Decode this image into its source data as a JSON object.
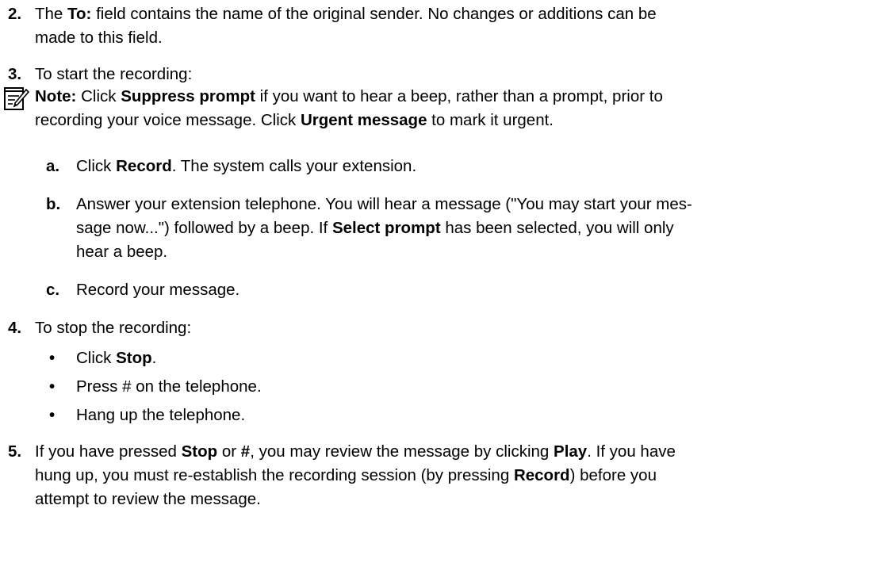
{
  "doc": {
    "s2": {
      "num": "2.",
      "p1": "The ",
      "b1": "To:",
      "p2": " field contains the name of the original sender. No changes or additions can be",
      "l2": "made to this field."
    },
    "s3": {
      "num": "3.",
      "text": "To start the recording:"
    },
    "note": {
      "label": "Note:",
      "p1": " Click ",
      "b1": "Suppress prompt",
      "p2": " if you want to hear a beep, rather than a prompt, prior to",
      "l2p1": "recording your voice message. Click ",
      "l2b1": "Urgent message",
      "l2p2": " to mark it urgent."
    },
    "a": {
      "label": "a.",
      "p1": "Click ",
      "b1": "Record",
      "p2": ". The system calls your extension."
    },
    "b": {
      "label": "b.",
      "l1": "Answer your extension telephone. You will hear a message (\"You may start your mes-",
      "l2p1": "sage now...\") followed by a beep. If ",
      "l2b1": "Select prompt",
      "l2p2": " has been selected, you will only",
      "l3": "hear a beep."
    },
    "c": {
      "label": "c.",
      "text": "Record your message."
    },
    "s4": {
      "num": "4.",
      "text": "To stop the recording:",
      "bullet": "•",
      "b1p1": "Click ",
      "b1b": "Stop",
      "b1p2": ".",
      "b2": "Press # on the telephone.",
      "b3": "Hang up the telephone."
    },
    "s5": {
      "num": "5.",
      "l1p1": "If you have pressed ",
      "l1b1": "Stop",
      "l1p2": " or ",
      "l1b2": "#",
      "l1p3": ", you may review the message by clicking ",
      "l1b3": "Play",
      "l1p4": ". If you have",
      "l2p1": "hung up, you must re-establish the recording session (by pressing ",
      "l2b1": "Record",
      "l2p2": ") before you",
      "l3": "attempt to review the message."
    }
  }
}
